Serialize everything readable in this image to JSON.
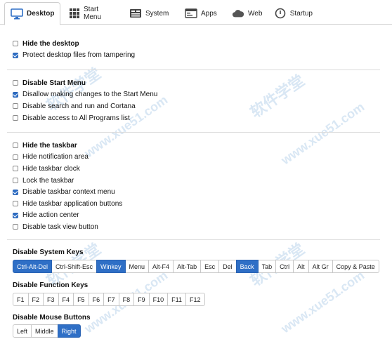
{
  "tabs": [
    {
      "label": "Desktop",
      "icon": "monitor-icon"
    },
    {
      "label": "Start Menu",
      "icon": "grid-icon"
    },
    {
      "label": "System",
      "icon": "system-icon"
    },
    {
      "label": "Apps",
      "icon": "apps-icon"
    },
    {
      "label": "Web",
      "icon": "cloud-icon"
    },
    {
      "label": "Startup",
      "icon": "power-icon"
    }
  ],
  "desktop_group": [
    {
      "label": "Hide the desktop",
      "checked": false
    },
    {
      "label": "Protect desktop files from tampering",
      "checked": true
    }
  ],
  "startmenu_group": [
    {
      "label": "Disable Start Menu",
      "checked": false
    },
    {
      "label": "Disallow making changes to the Start Menu",
      "checked": true
    },
    {
      "label": "Disable search and run and Cortana",
      "checked": false
    },
    {
      "label": "Disable access to All Programs list",
      "checked": false
    }
  ],
  "taskbar_group": [
    {
      "label": "Hide the taskbar",
      "checked": false
    },
    {
      "label": "Hide notification area",
      "checked": false
    },
    {
      "label": "Hide taskbar clock",
      "checked": false
    },
    {
      "label": "Lock the taskbar",
      "checked": false
    },
    {
      "label": "Disable taskbar context menu",
      "checked": true
    },
    {
      "label": "Hide taskbar application buttons",
      "checked": false
    },
    {
      "label": "Hide action center",
      "checked": true
    },
    {
      "label": "Disable task view button",
      "checked": false
    }
  ],
  "system_keys": {
    "title": "Disable System Keys",
    "keys": [
      {
        "label": "Ctrl-Alt-Del",
        "on": true
      },
      {
        "label": "Ctrl-Shift-Esc",
        "on": false
      },
      {
        "label": "Winkey",
        "on": true
      },
      {
        "label": "Menu",
        "on": false
      },
      {
        "label": "Alt-F4",
        "on": false
      },
      {
        "label": "Alt-Tab",
        "on": false
      },
      {
        "label": "Esc",
        "on": false
      },
      {
        "label": "Del",
        "on": false
      },
      {
        "label": "Back",
        "on": true
      },
      {
        "label": "Tab",
        "on": false
      },
      {
        "label": "Ctrl",
        "on": false
      },
      {
        "label": "Alt",
        "on": false
      },
      {
        "label": "Alt Gr",
        "on": false
      },
      {
        "label": "Copy & Paste",
        "on": false
      }
    ]
  },
  "function_keys": {
    "title": "Disable Function Keys",
    "keys": [
      {
        "label": "F1",
        "on": false
      },
      {
        "label": "F2",
        "on": false
      },
      {
        "label": "F3",
        "on": false
      },
      {
        "label": "F4",
        "on": false
      },
      {
        "label": "F5",
        "on": false
      },
      {
        "label": "F6",
        "on": false
      },
      {
        "label": "F7",
        "on": false
      },
      {
        "label": "F8",
        "on": false
      },
      {
        "label": "F9",
        "on": false
      },
      {
        "label": "F10",
        "on": false
      },
      {
        "label": "F11",
        "on": false
      },
      {
        "label": "F12",
        "on": false
      }
    ]
  },
  "mouse_buttons": {
    "title": "Disable Mouse Buttons",
    "keys": [
      {
        "label": "Left",
        "on": false
      },
      {
        "label": "Middle",
        "on": false
      },
      {
        "label": "Right",
        "on": true
      }
    ]
  },
  "watermark": {
    "text_cn": "软件学堂",
    "text_url": "www.xue51.com"
  },
  "colors": {
    "accent": "#2f6fc6"
  }
}
